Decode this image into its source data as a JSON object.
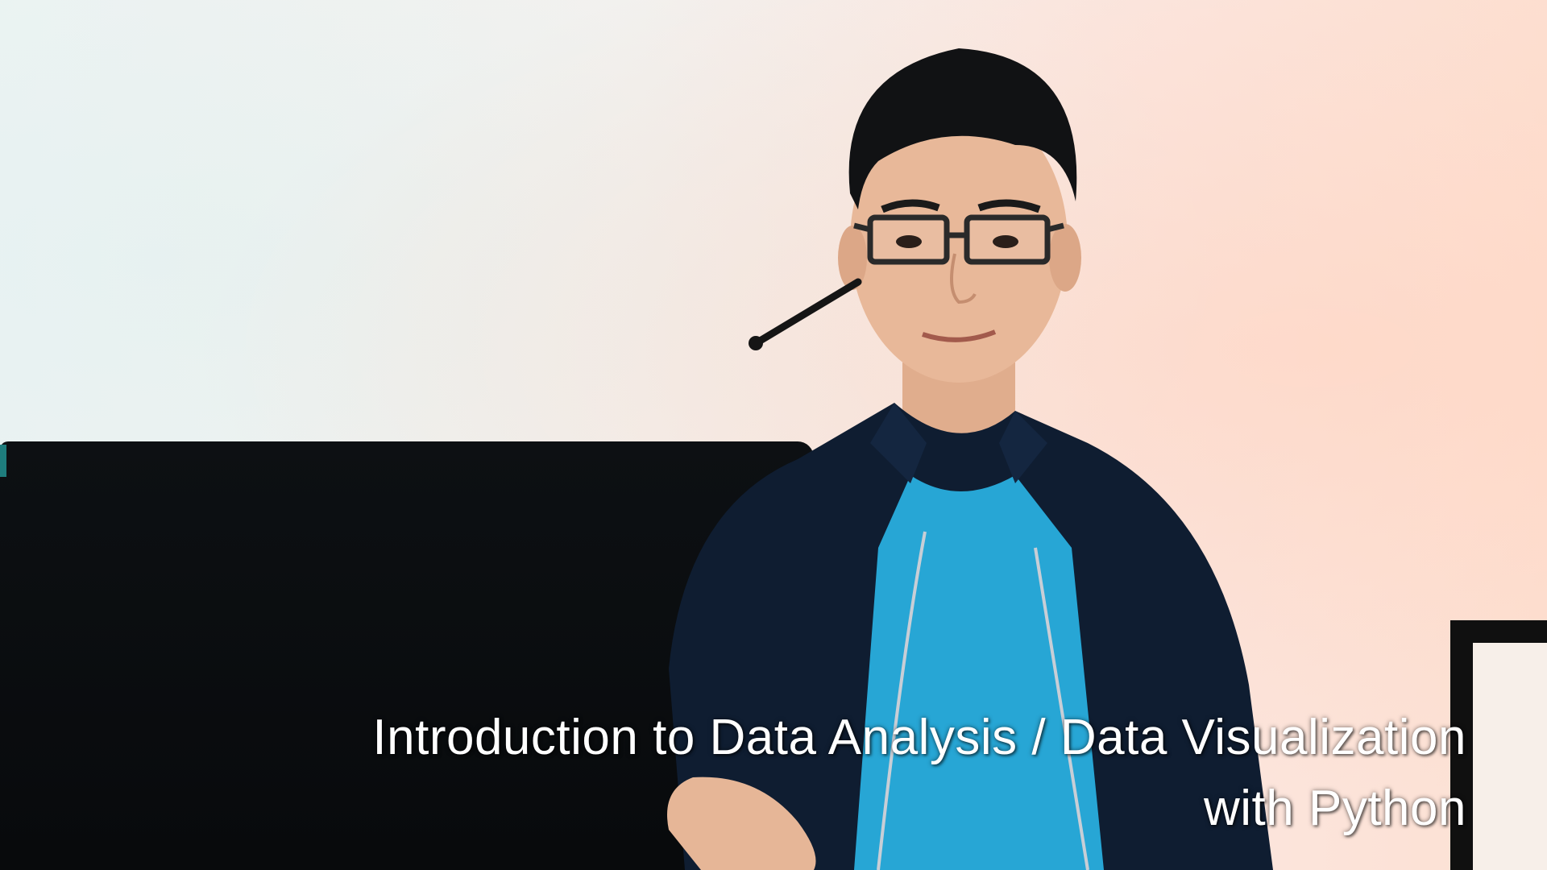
{
  "caption": {
    "line1": "Introduction to Data Analysis / Data Visualization",
    "line2": "with Python"
  },
  "colors": {
    "wall_left": "#eef4f3",
    "wall_right": "#fde0d2",
    "sofa": "#0b0d10",
    "jacket": "#0f1e33",
    "tshirt": "#25a6d6",
    "skin": "#e8b89a",
    "hair": "#111111"
  },
  "scene": {
    "subject": "person",
    "objects": [
      "headset-microphone",
      "glasses",
      "sofa",
      "picture-frame"
    ]
  }
}
